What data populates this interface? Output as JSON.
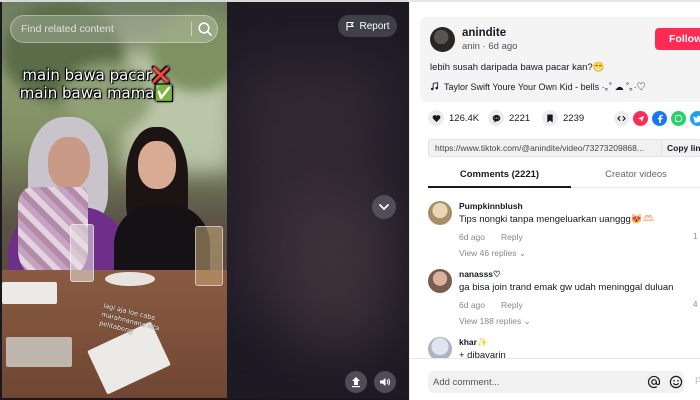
{
  "video": {
    "search_placeholder": "Find related content",
    "overlay_line_1": "main bawa pacar❌",
    "overlay_line_2": "main bawa mama✅",
    "overlay_handwriting": "lagi aja loe cabe marahnanana kita pelitabeng",
    "report_label": "Report"
  },
  "author": {
    "name": "anindite",
    "meta": "anin · 6d ago",
    "follow_label": "Follow",
    "caption": "lebih susah daripada bawa pacar kan?😁",
    "music": "Taylor Swift Youre Your Own Kid - bells ·｡˚ ☁︎ ˚｡·♡"
  },
  "stats": {
    "likes": "126.4K",
    "comments": "2221",
    "saves": "2239"
  },
  "share": {
    "link": "https://www.tiktok.com/@anindite/video/73273209868...",
    "copy_label": "Copy link"
  },
  "tabs": {
    "comments": "Comments (2221)",
    "creator_videos": "Creator videos"
  },
  "comments": [
    {
      "user": "Pumpkinnblush",
      "text": "Tips nongki tanpa mengeluarkan uanggg😻🫶🏻",
      "time": "6d ago",
      "reply": "Reply",
      "replies": "View 46 replies ⌄",
      "likes": "1"
    },
    {
      "user": "nanasss♡",
      "text": "ga bisa join trand emak gw udah meninggal duluan",
      "time": "6d ago",
      "reply": "Reply",
      "replies": "View 188 replies ⌄",
      "likes": "4"
    },
    {
      "user": "khar✨",
      "text": "+ dibayarin"
    }
  ],
  "comment_bar": {
    "placeholder": "Add comment...",
    "post_label": "P"
  },
  "colors": {
    "follow": "#fe2c55",
    "text": "#161823",
    "panel_bg": "#f4f4f5"
  }
}
